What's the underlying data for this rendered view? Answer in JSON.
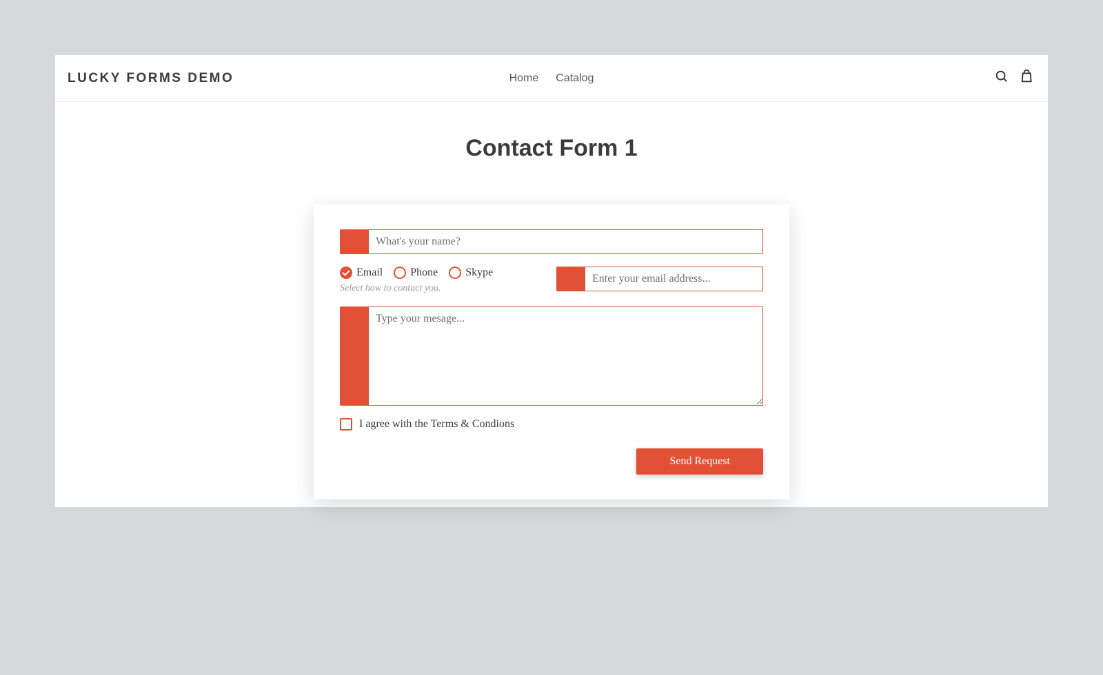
{
  "header": {
    "brand": "LUCKY FORMS DEMO",
    "nav": {
      "home": "Home",
      "catalog": "Catalog"
    }
  },
  "page": {
    "title": "Contact Form 1"
  },
  "form": {
    "name": {
      "placeholder": "What's your name?",
      "value": ""
    },
    "contact_method": {
      "options": {
        "email": "Email",
        "phone": "Phone",
        "skype": "Skype"
      },
      "selected": "email",
      "helper": "Select how to contact you."
    },
    "email": {
      "placeholder": "Enter your email address...",
      "value": ""
    },
    "message": {
      "placeholder": "Type your mesage...",
      "value": ""
    },
    "terms": {
      "label": "I agree with the Terms & Condions",
      "checked": false
    },
    "submit": {
      "label": "Send Request"
    }
  },
  "colors": {
    "accent": "#e25035"
  }
}
